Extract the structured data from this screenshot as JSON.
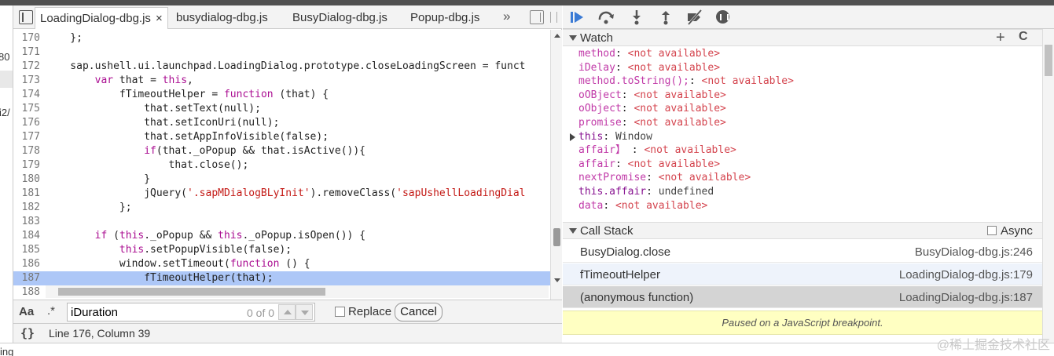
{
  "editor": {
    "tabs": [
      {
        "label": "LoadingDialog-dbg.js",
        "close": "×"
      },
      {
        "label": "busydialog-dbg.js"
      },
      {
        "label": "BusyDialog-dbg.js"
      },
      {
        "label": "Popup-dbg.js"
      }
    ],
    "more_tabs": "»",
    "gutter_fragments": [
      "80",
      "i2/"
    ],
    "code_lines": [
      {
        "n": "170",
        "text": "    };"
      },
      {
        "n": "171",
        "text": ""
      },
      {
        "n": "172",
        "text": "    sap.ushell.ui.launchpad.LoadingDialog.prototype.closeLoadingScreen = funct"
      },
      {
        "n": "173",
        "text": "        var that = this,"
      },
      {
        "n": "174",
        "text": "            fTimeoutHelper = function (that) {"
      },
      {
        "n": "175",
        "text": "                that.setText(null);"
      },
      {
        "n": "176",
        "text": "                that.setIconUri(null);"
      },
      {
        "n": "177",
        "text": "                that.setAppInfoVisible(false);"
      },
      {
        "n": "178",
        "text": "                if(that._oPopup && that.isActive()){"
      },
      {
        "n": "179",
        "text": "                    that.close();"
      },
      {
        "n": "180",
        "text": "                }"
      },
      {
        "n": "181",
        "text": "                jQuery('.sapMDialogBLyInit').removeClass('sapUshellLoadingDial"
      },
      {
        "n": "182",
        "text": "            };"
      },
      {
        "n": "183",
        "text": ""
      },
      {
        "n": "184",
        "text": "        if (this._oPopup && this._oPopup.isOpen()) {"
      },
      {
        "n": "185",
        "text": "            this.setPopupVisible(false);"
      },
      {
        "n": "186",
        "text": "            window.setTimeout(function () {"
      },
      {
        "n": "187",
        "text": "                fTimeoutHelper(that);"
      },
      {
        "n": "188",
        "text": ""
      }
    ],
    "highlighted_line": "187"
  },
  "find": {
    "case_label": "Aa",
    "regex_label": ".*",
    "query": "iDuration",
    "count": "0 of 0",
    "replace_label": "Replace",
    "cancel_label": "Cancel"
  },
  "status": {
    "pretty_print_label": "{}",
    "position": "Line 176, Column 39"
  },
  "watch": {
    "title": "Watch",
    "add_label": "+",
    "refresh_label": "C",
    "items": [
      {
        "name": "method",
        "value": "<not available>"
      },
      {
        "name": "iDelay",
        "value": "<not available>"
      },
      {
        "name": "method.toString();",
        "value": "<not available>"
      },
      {
        "name": "oOBject",
        "value": "<not available>"
      },
      {
        "name": "oObject",
        "value": "<not available>"
      },
      {
        "name": "promise",
        "value": "<not available>"
      },
      {
        "name": "this",
        "value": "Window",
        "expandable": true
      },
      {
        "name": "affair】",
        "value": "<not available>",
        "separator": " : "
      },
      {
        "name": "affair",
        "value": "<not available>"
      },
      {
        "name": "nextPromise",
        "value": "<not available>"
      },
      {
        "name": "this.affair",
        "value": "undefined",
        "real": true
      },
      {
        "name": "data",
        "value": "<not available>"
      }
    ]
  },
  "callstack": {
    "title": "Call Stack",
    "async_label": "Async",
    "frames": [
      {
        "name": "BusyDialog.close",
        "location": "BusyDialog-dbg.js:246"
      },
      {
        "name": "fTimeoutHelper",
        "location": "LoadingDialog-dbg.js:179"
      },
      {
        "name": "(anonymous function)",
        "location": "LoadingDialog-dbg.js:187"
      }
    ],
    "paused_message": "Paused on a JavaScript breakpoint."
  },
  "bottom": {
    "text": "ing",
    "watermark": "@稀土掘金技术社区"
  }
}
